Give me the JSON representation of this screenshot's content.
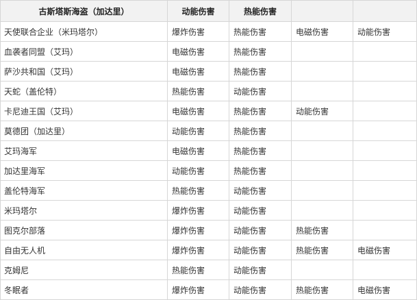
{
  "headers": [
    "古斯塔斯海盗（加达里）",
    "动能伤害",
    "热能伤害",
    "",
    ""
  ],
  "rows": [
    {
      "name": "天使联合企业（米玛塔尔）",
      "d1": "爆炸伤害",
      "d2": "热能伤害",
      "d3": "电磁伤害",
      "d4": "动能伤害"
    },
    {
      "name": "血袭者同盟（艾玛）",
      "d1": "电磁伤害",
      "d2": "热能伤害",
      "d3": "",
      "d4": ""
    },
    {
      "name": "萨沙共和国（艾玛）",
      "d1": "电磁伤害",
      "d2": "热能伤害",
      "d3": "",
      "d4": ""
    },
    {
      "name": "天蛇（盖伦特）",
      "d1": "热能伤害",
      "d2": "动能伤害",
      "d3": "",
      "d4": ""
    },
    {
      "name": "卡尼迪王国（艾玛）",
      "d1": "电磁伤害",
      "d2": "热能伤害",
      "d3": "动能伤害",
      "d4": ""
    },
    {
      "name": "莫德团（加达里）",
      "d1": "动能伤害",
      "d2": "热能伤害",
      "d3": "",
      "d4": ""
    },
    {
      "name": "艾玛海军",
      "d1": "电磁伤害",
      "d2": "热能伤害",
      "d3": "",
      "d4": ""
    },
    {
      "name": "加达里海军",
      "d1": "动能伤害",
      "d2": "热能伤害",
      "d3": "",
      "d4": ""
    },
    {
      "name": "盖伦特海军",
      "d1": "热能伤害",
      "d2": "动能伤害",
      "d3": "",
      "d4": ""
    },
    {
      "name": "米玛塔尔",
      "d1": "爆炸伤害",
      "d2": "动能伤害",
      "d3": "",
      "d4": ""
    },
    {
      "name": "图克尔部落",
      "d1": "爆炸伤害",
      "d2": "动能伤害",
      "d3": "热能伤害",
      "d4": ""
    },
    {
      "name": "自由无人机",
      "d1": "爆炸伤害",
      "d2": "动能伤害",
      "d3": "热能伤害",
      "d4": "电磁伤害"
    },
    {
      "name": "克姆尼",
      "d1": "热能伤害",
      "d2": "动能伤害",
      "d3": "",
      "d4": ""
    },
    {
      "name": "冬眠者",
      "d1": "爆炸伤害",
      "d2": "动能伤害",
      "d3": "热能伤害",
      "d4": "电磁伤害"
    }
  ]
}
